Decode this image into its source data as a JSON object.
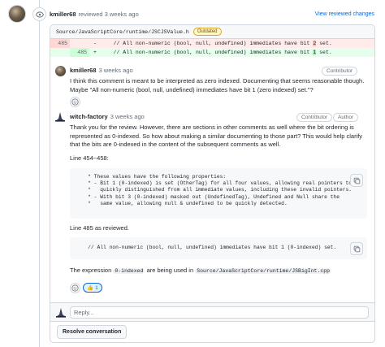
{
  "header": {
    "user": "kmiller68",
    "action": "reviewed 3 weeks ago",
    "view_changes_link": "View reviewed changes"
  },
  "file": {
    "path": "Source/JavaScriptCore/runtime/JSCJSValue.h",
    "status_badge": "Outdated"
  },
  "diff": {
    "deleted_line": {
      "number": "485",
      "sign": "-",
      "before": "    // All non-numeric (bool, null, undefined) immediates have bit ",
      "highlight": "2",
      "after": " set."
    },
    "added_line": {
      "number": "485",
      "sign": "+",
      "before": "    // All non-numeric (bool, null, undefined) immediates have bit ",
      "highlight": "1",
      "after": " set."
    }
  },
  "comment1": {
    "author": "kmiller68",
    "time": "3 weeks ago",
    "role": "Contributor",
    "body": "I think this comment is meant to be interpreted as zero indexed. Documenting that seems reasonable though. Maybe \"All non-numeric (bool, null, undefined) immediates have bit 1 (zero indexed) set.\"?"
  },
  "comment2": {
    "author": "witch-factory",
    "time": "3 weeks ago",
    "role": "Contributor",
    "role2": "Author",
    "para1": "Thank you for the review. However, there are sections in other comments as well where the bit ordering is represented as 0-indexed. So how about making a similar documenting to those part? This would help clarify that the bits are 0-indexed in the content of the subsequent comments as well.",
    "line_ref1": "Line 454~458:",
    "code1": "    * These values have the following properties:\n    * - Bit 1 (0-indexed) is set (OtherTag) for all four values, allowing real pointers to be\n    *   quickly distinguished from all immediate values, including these invalid pointers.\n    * - With bit 3 (0-indexed) masked out (UndefinedTag), Undefined and Null share the\n    *   same value, allowing null & undefined to be quickly detected.",
    "line_ref2": "Line 485 as reviewed.",
    "code2": "    // All non-numeric (bool, null, undefined) immediates have bit 1 (0-indexed) set.",
    "expr_prefix": "The expression",
    "expr_code": "0-indexed",
    "expr_middle": "are being used in",
    "expr_path": "Source/JavaScriptCore/runtime/JSBigInt.cpp",
    "reaction_emoji": "👍",
    "reaction_count": "1"
  },
  "reply_placeholder": "Reply...",
  "resolve_button": "Resolve conversation",
  "icons": [
    "eye-icon",
    "copy-icon",
    "smiley-icon",
    "thumbs-up-icon"
  ]
}
